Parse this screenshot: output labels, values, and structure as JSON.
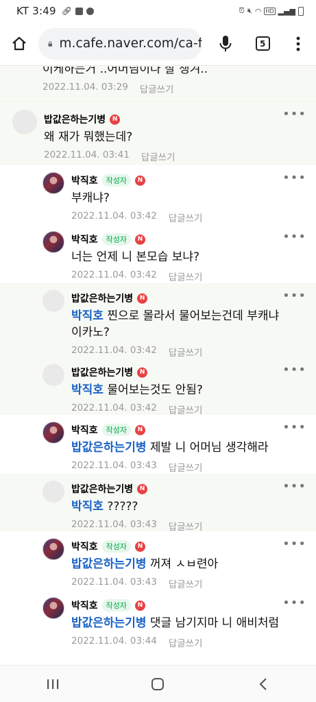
{
  "status": {
    "time": "KT 3:49",
    "hd": "HD"
  },
  "browser": {
    "url": "m.cafe.naver.com/ca-f",
    "tab_count": "5"
  },
  "reply_label": "답글쓰기",
  "author_badge": "작성자",
  "n_badge": "N",
  "more_label": "•••",
  "comments": [
    {
      "text": "이케하는거 ..어머님이나 잘 챙겨..",
      "time": "2022.11.04. 03:29"
    },
    {
      "nick": "밥값은하는기병",
      "text": "왜 재가 뭐했는데?",
      "time": "2022.11.04. 03:41"
    },
    {
      "nick": "박직호",
      "text": "부캐냐?",
      "time": "2022.11.04. 03:42"
    },
    {
      "nick": "박직호",
      "text": "너는 언제 니 본모습 보냐?",
      "time": "2022.11.04. 03:42"
    },
    {
      "nick": "밥값은하는기병",
      "mention": "박직호",
      "text": " 찐으로 몰라서 물어보는건데 부캐냐 이카노?",
      "time": "2022.11.04. 03:42"
    },
    {
      "nick": "밥값은하는기병",
      "mention": "박직호",
      "text": " 물어보는것도 안됨?",
      "time": "2022.11.04. 03:42"
    },
    {
      "nick": "박직호",
      "mention": "밥값은하는기병",
      "text": " 제발 니 어머님 생각해라",
      "time": "2022.11.04. 03:43"
    },
    {
      "nick": "밥값은하는기병",
      "mention": "박직호",
      "text": " ?????",
      "time": "2022.11.04. 03:43"
    },
    {
      "nick": "박직호",
      "mention": "밥값은하는기병",
      "text": " 꺼져 ㅅㅂ련아",
      "time": "2022.11.04. 03:43"
    },
    {
      "nick": "박직호",
      "mention": "밥값은하는기병",
      "text": " 댓글 남기지마 니 애비처럼",
      "time": "2022.11.04. 03:44"
    }
  ]
}
